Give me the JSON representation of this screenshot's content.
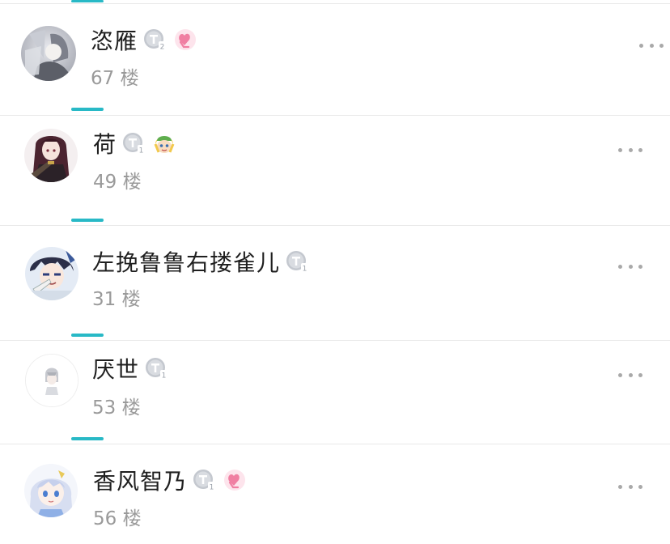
{
  "users": [
    {
      "name": "恣雁",
      "floor": "67 楼",
      "level_badge": "T2",
      "extra_badge": "hand-heart-icon"
    },
    {
      "name": "荷",
      "floor": "49 楼",
      "level_badge": "T1",
      "extra_badge": "cartoon-avatar-icon"
    },
    {
      "name": "左挽鲁鲁右搂雀儿",
      "floor": "31 楼",
      "level_badge": "T1",
      "extra_badge": ""
    },
    {
      "name": "厌世",
      "floor": "53 楼",
      "level_badge": "T1",
      "extra_badge": ""
    },
    {
      "name": "香风智乃",
      "floor": "56 楼",
      "level_badge": "T1",
      "extra_badge": "hand-heart-icon"
    }
  ],
  "colors": {
    "accent_teal": "#28b9c6",
    "name_text": "#1f1f1f",
    "floor_text": "#9a9a9a",
    "divider": "#e9e9e9",
    "badge_silver": "#b8bdc6",
    "heart_pink": "#f07fa2"
  }
}
